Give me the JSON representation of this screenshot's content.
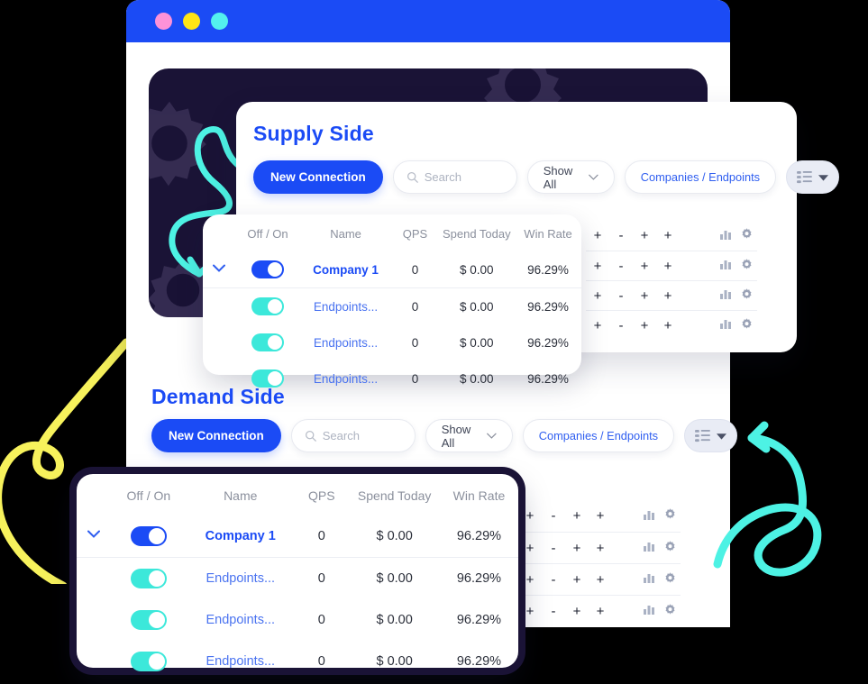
{
  "browser": {
    "dots": [
      "pink-dot",
      "yellow-dot",
      "cyan-dot"
    ]
  },
  "colors": {
    "accent_blue": "#1b4bf5",
    "toggle_cyan": "#3ce8da",
    "dark_panel": "#1a1336",
    "link_blue": "#4a73f0",
    "muted_text": "#8b909d",
    "squiggle_yellow": "#f7f25c",
    "squiggle_cyan": "#4df2e4"
  },
  "supply": {
    "title": "Supply Side",
    "toolbar": {
      "new_connection_label": "New Connection",
      "search_placeholder": "Search",
      "search_value": "",
      "show_all_label": "Show All",
      "companies_endpoints_label": "Companies / Endpoints",
      "grid_view_label": ""
    },
    "table": {
      "columns": [
        "Off / On",
        "Name",
        "QPS",
        "Spend Today",
        "Win Rate"
      ],
      "rows": [
        {
          "expander": true,
          "toggle": "on-blue",
          "name": "Company 1",
          "name_type": "company",
          "qps": "0",
          "spend": "$ 0.00",
          "win_rate": "96.29%"
        },
        {
          "expander": false,
          "toggle": "on-cyan",
          "name": "Endpoints...",
          "name_type": "endpoint",
          "qps": "0",
          "spend": "$ 0.00",
          "win_rate": "96.29%"
        },
        {
          "expander": false,
          "toggle": "on-cyan",
          "name": "Endpoints...",
          "name_type": "endpoint",
          "qps": "0",
          "spend": "$ 0.00",
          "win_rate": "96.29%"
        },
        {
          "expander": false,
          "toggle": "on-cyan",
          "name": "Endpoints...",
          "name_type": "endpoint",
          "qps": "0",
          "spend": "$ 0.00",
          "win_rate": "96.29%"
        }
      ],
      "action_rows": [
        {
          "signs": [
            "+",
            "-",
            "+",
            "+"
          ],
          "icons": [
            "chart-bar-icon",
            "gear-icon"
          ]
        },
        {
          "signs": [
            "+",
            "-",
            "+",
            "+"
          ],
          "icons": [
            "chart-bar-icon",
            "gear-icon"
          ]
        },
        {
          "signs": [
            "+",
            "-",
            "+",
            "+"
          ],
          "icons": [
            "chart-bar-icon",
            "gear-icon"
          ]
        },
        {
          "signs": [
            "+",
            "-",
            "+",
            "+"
          ],
          "icons": [
            "chart-bar-icon",
            "gear-icon"
          ]
        }
      ]
    }
  },
  "demand": {
    "title": "Demand Side",
    "toolbar": {
      "new_connection_label": "New Connection",
      "search_placeholder": "Search",
      "search_value": "",
      "show_all_label": "Show All",
      "companies_endpoints_label": "Companies / Endpoints",
      "grid_view_label": ""
    },
    "table": {
      "columns": [
        "Off / On",
        "Name",
        "QPS",
        "Spend Today",
        "Win Rate"
      ],
      "rows": [
        {
          "expander": true,
          "toggle": "on-blue",
          "name": "Company 1",
          "name_type": "company",
          "qps": "0",
          "spend": "$ 0.00",
          "win_rate": "96.29%"
        },
        {
          "expander": false,
          "toggle": "on-cyan",
          "name": "Endpoints...",
          "name_type": "endpoint",
          "qps": "0",
          "spend": "$ 0.00",
          "win_rate": "96.29%"
        },
        {
          "expander": false,
          "toggle": "on-cyan",
          "name": "Endpoints...",
          "name_type": "endpoint",
          "qps": "0",
          "spend": "$ 0.00",
          "win_rate": "96.29%"
        },
        {
          "expander": false,
          "toggle": "on-cyan",
          "name": "Endpoints...",
          "name_type": "endpoint",
          "qps": "0",
          "spend": "$ 0.00",
          "win_rate": "96.29%"
        }
      ],
      "action_rows": [
        {
          "signs": [
            "+",
            "-",
            "+",
            "+"
          ],
          "icons": [
            "chart-bar-icon",
            "gear-icon"
          ]
        },
        {
          "signs": [
            "+",
            "-",
            "+",
            "+"
          ],
          "icons": [
            "chart-bar-icon",
            "gear-icon"
          ]
        },
        {
          "signs": [
            "+",
            "-",
            "+",
            "+"
          ],
          "icons": [
            "chart-bar-icon",
            "gear-icon"
          ]
        },
        {
          "signs": [
            "+",
            "-",
            "+",
            "+"
          ],
          "icons": [
            "chart-bar-icon",
            "gear-icon"
          ]
        }
      ]
    }
  }
}
